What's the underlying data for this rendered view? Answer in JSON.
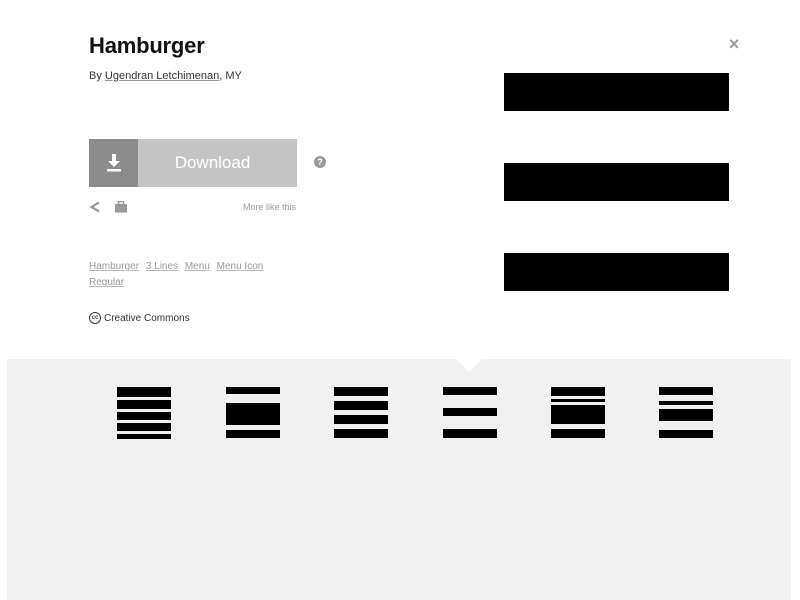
{
  "icon": {
    "title": "Hamburger",
    "by_prefix": "By",
    "author": "Ugendran Letchimenan",
    "country": ", MY"
  },
  "actions": {
    "download_label": "Download",
    "more_like_this": "More like this",
    "help": "?"
  },
  "tags": [
    "Hamburger",
    "3 Lines",
    "Menu",
    "Menu Icon",
    "Regular"
  ],
  "license": {
    "label": "Creative Commons",
    "badge": "cc"
  },
  "close": "×",
  "variations": [
    {
      "name": "hamburger-variant-1",
      "selected": false
    },
    {
      "name": "hamburger-variant-2",
      "selected": false
    },
    {
      "name": "hamburger-variant-3",
      "selected": false
    },
    {
      "name": "hamburger-variant-4",
      "selected": true
    },
    {
      "name": "hamburger-variant-5",
      "selected": false
    },
    {
      "name": "hamburger-variant-6",
      "selected": false
    }
  ],
  "colors": {
    "download_bg": "#c4c4c4",
    "download_icon_bg": "#8c8c8c",
    "strip_bg": "#f1f1f1",
    "selected_bg": "#bdbdbd"
  }
}
